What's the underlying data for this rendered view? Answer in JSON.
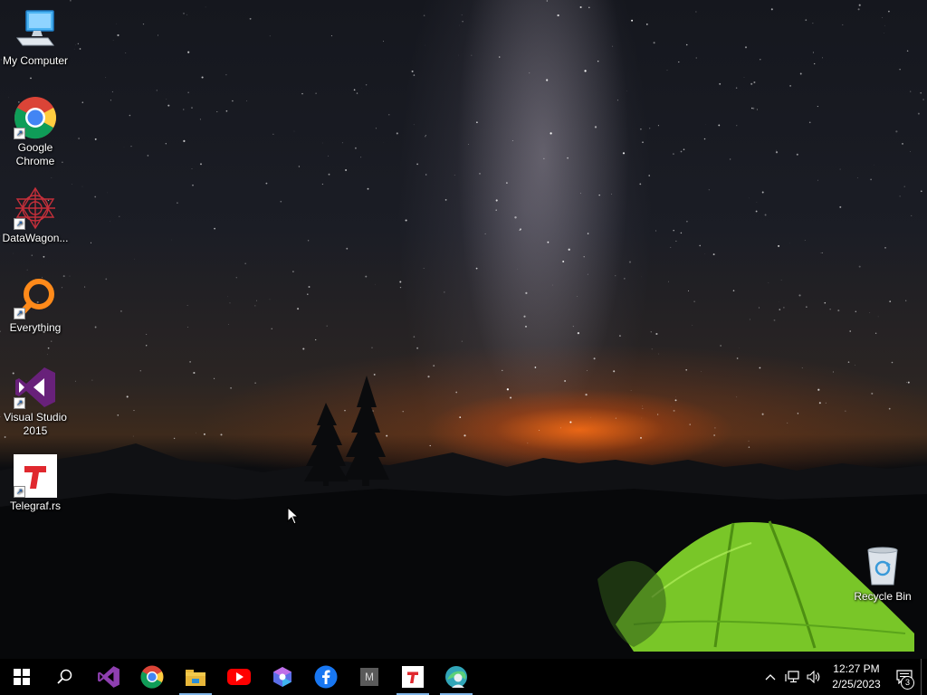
{
  "desktop": {
    "icons": [
      {
        "label": "My Computer",
        "icon": "computer-icon"
      },
      {
        "label": "Google Chrome",
        "icon": "chrome-icon"
      },
      {
        "label": "DataWagon...",
        "icon": "datawagon-icon"
      },
      {
        "label": "Everything",
        "icon": "everything-search-icon"
      },
      {
        "label": "Visual Studio 2015",
        "icon": "visual-studio-icon"
      },
      {
        "label": "Telegraf.rs",
        "icon": "telegraf-icon"
      },
      {
        "label": "Recycle Bin",
        "icon": "recycle-bin-icon"
      }
    ]
  },
  "taskbar": {
    "buttons": [
      {
        "icon": "windows-start-icon"
      },
      {
        "icon": "search-icon"
      },
      {
        "icon": "visual-studio-icon"
      },
      {
        "icon": "chrome-icon"
      },
      {
        "icon": "file-explorer-icon",
        "active": true
      },
      {
        "icon": "youtube-icon"
      },
      {
        "icon": "copilot-icon"
      },
      {
        "icon": "facebook-icon"
      },
      {
        "icon": "m-app-icon",
        "text": "M"
      },
      {
        "icon": "telegraf-icon",
        "active": true
      },
      {
        "icon": "edge-profile-icon",
        "active": true
      }
    ],
    "tray": {
      "time": "12:27 PM",
      "date": "2/25/2023",
      "notification_count": "3"
    }
  },
  "colors": {
    "taskbar_bg": "#000000",
    "active_indicator": "#7fb4e6",
    "tent_green": "#7fd12a",
    "horizon_glow": "#ff6e14"
  }
}
